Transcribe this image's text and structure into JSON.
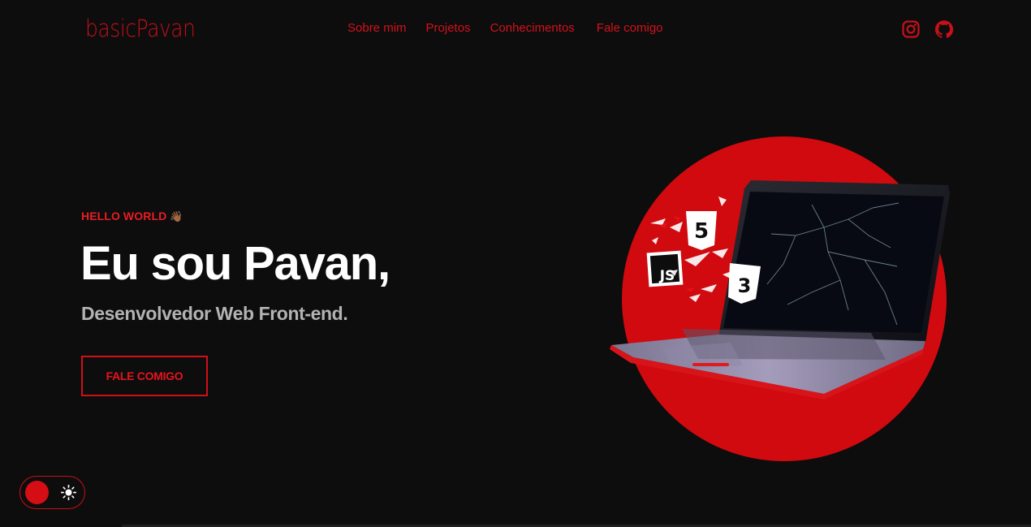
{
  "brand": {
    "logo": "basicPavan"
  },
  "nav": {
    "items": [
      "Sobre mim",
      "Projetos",
      "Conhecimentos",
      "Fale comigo"
    ]
  },
  "social": {
    "icons": [
      "instagram-icon",
      "github-icon"
    ]
  },
  "hero": {
    "greeting": "HELLO WORLD",
    "greeting_emoji": "👋🏾",
    "title": "Eu sou Pavan,",
    "subtitle": "Desenvolvedor Web Front-end.",
    "cta_label": "FALE COMIGO",
    "image_badges": [
      "5",
      "JS",
      "3"
    ]
  },
  "theme_toggle": {
    "state": "dark",
    "icon": "sun-icon"
  },
  "colors": {
    "accent": "#d50d15",
    "background": "#0d0d0d",
    "title": "#ffffff",
    "subtitle": "#b3b3b3"
  }
}
